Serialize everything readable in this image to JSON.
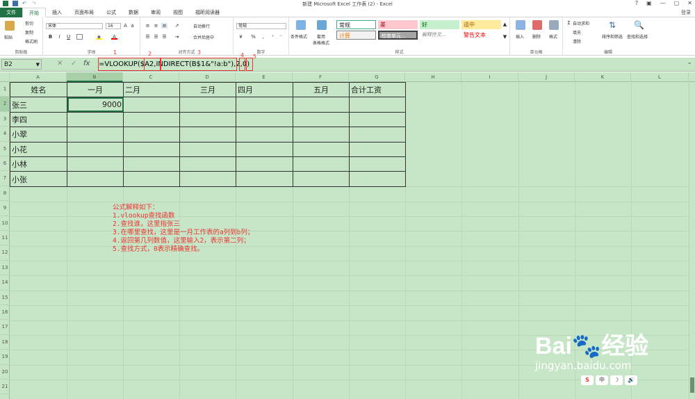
{
  "window": {
    "title": "新建 Microsoft Excel 工作表 (2) - Excel",
    "controls": [
      "?",
      "▣",
      "—",
      "▢",
      "✕"
    ]
  },
  "tabs": [
    "文件",
    "开始",
    "插入",
    "页面布局",
    "公式",
    "数据",
    "审阅",
    "视图",
    "福昕阅读器"
  ],
  "signin": "登录",
  "ribbon": {
    "clipboard": {
      "paste": "粘贴",
      "cut": "剪切",
      "copy": "复制",
      "painter": "格式刷",
      "label": "剪贴板"
    },
    "font": {
      "name": "宋体",
      "size": "16",
      "bold": "B",
      "italic": "I",
      "underline": "U",
      "label": "字体"
    },
    "align": {
      "wrap": "自动换行",
      "merge": "合并后居中",
      "label": "对齐方式"
    },
    "number": {
      "format": "常规",
      "pct": "%",
      "comma": ",",
      "label": "数字"
    },
    "styles": {
      "cond": "条件格式",
      "table": "套用\n表格格式",
      "cells": [
        "常规",
        "差",
        "好",
        "适中",
        "计算",
        "检查单元...",
        "解释性文...",
        "警告文本"
      ],
      "label": "样式"
    },
    "cellgrp": {
      "insert": "插入",
      "delete": "删除",
      "format": "格式",
      "label": "单元格"
    },
    "edit": {
      "autosum": "自动求和",
      "fill": "填充",
      "clear": "清除",
      "sort": "排序和筛选",
      "find": "查找和选择",
      "label": "编辑"
    }
  },
  "formula_bar": {
    "name_box": "B2",
    "cancel": "✕",
    "enter": "✓",
    "fx": "fx",
    "formula": "=VLOOKUP($A2,INDIRECT(B$1&\"!a:b\"),2,0)",
    "markers": [
      "1",
      "2",
      "3",
      "4",
      "5"
    ]
  },
  "columns": [
    "A",
    "B",
    "C",
    "D",
    "E",
    "F",
    "G",
    "H",
    "I",
    "J",
    "K",
    "L"
  ],
  "rows": [
    "1",
    "2",
    "3",
    "4",
    "5",
    "6",
    "7",
    "8",
    "9",
    "10",
    "11",
    "12",
    "13",
    "14",
    "15",
    "16",
    "17",
    "18",
    "19",
    "20",
    "21"
  ],
  "table": {
    "header": [
      "姓名",
      "一月",
      "二月",
      "三月",
      "四月",
      "五月",
      "合计工资"
    ],
    "rows": [
      [
        "张三",
        "9000",
        "",
        "",
        "",
        "",
        ""
      ],
      [
        "李四",
        "",
        "",
        "",
        "",
        "",
        ""
      ],
      [
        "小翠",
        "",
        "",
        "",
        "",
        "",
        ""
      ],
      [
        "小花",
        "",
        "",
        "",
        "",
        "",
        ""
      ],
      [
        "小林",
        "",
        "",
        "",
        "",
        "",
        ""
      ],
      [
        "小张",
        "",
        "",
        "",
        "",
        "",
        ""
      ]
    ]
  },
  "note": [
    "公式解释如下：",
    "1.vlookup查找函数",
    "2.查找谁，这里指张三",
    "3.在哪里查找，这里是一月工作表的a列到b列；",
    "4.返回第几列数值，这里输入2，表示第二列；",
    "5.查找方式，0表示精确查找。"
  ],
  "watermark": {
    "brand": "Bai🐾经验",
    "url": "jingyan.baidu.com"
  },
  "bubbles": [
    "S",
    "中",
    "☽",
    "🔊"
  ]
}
